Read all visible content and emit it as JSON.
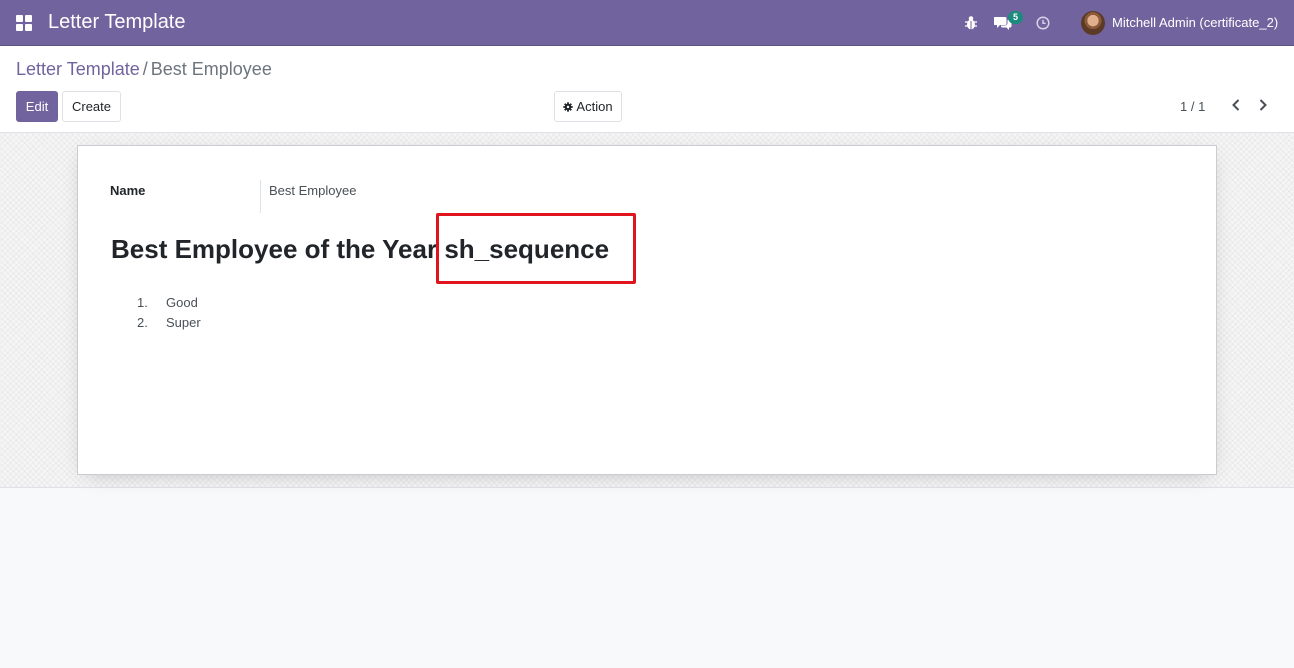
{
  "navbar": {
    "app_title": "Letter Template",
    "messages_badge": "5",
    "user_name": "Mitchell Admin (certificate_2)",
    "accent_color": "#71639e"
  },
  "breadcrumb": {
    "parent": "Letter Template",
    "separator": "/",
    "current": "Best Employee"
  },
  "toolbar": {
    "edit_label": "Edit",
    "create_label": "Create",
    "action_label": "Action"
  },
  "pager": {
    "value": "1 / 1"
  },
  "form": {
    "name_label": "Name",
    "name_value": "Best Employee",
    "heading_text": "Best Employee of the Year",
    "heading_token": "sh_sequence",
    "list": [
      {
        "num": "1.",
        "text": "Good"
      },
      {
        "num": "2.",
        "text": "Super"
      }
    ]
  }
}
